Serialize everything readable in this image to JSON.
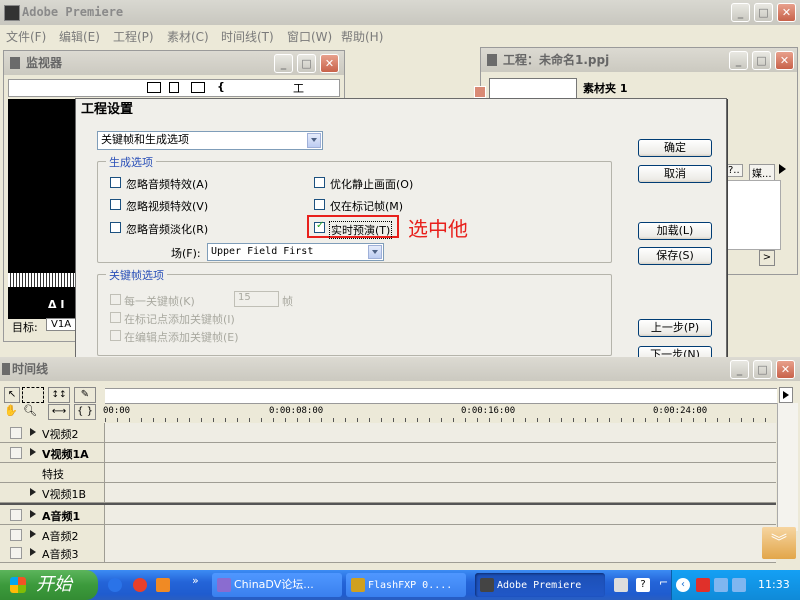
{
  "app": {
    "title": "Adobe Premiere",
    "menu": [
      "文件(F)",
      "编辑(E)",
      "工程(P)",
      "素材(C)",
      "时间线(T)",
      "窗口(W)",
      "帮助(H)"
    ]
  },
  "monitor": {
    "title": "监视器",
    "tool_label": "工",
    "target_label": "目标:",
    "target_value": "V1A",
    "marker_text": "Δ I"
  },
  "project": {
    "title": "工程：未命名1.ppj",
    "bin_label": "素材夹 1",
    "col_a": "?..",
    "col_b": "媒..."
  },
  "dialog": {
    "title": "工程设置",
    "category_select": "关键帧和生成选项",
    "render_group": {
      "label": "生成选项",
      "options": [
        {
          "label": "忽略音频特效(A)",
          "checked": false
        },
        {
          "label": "忽略视频特效(V)",
          "checked": false
        },
        {
          "label": "忽略音频淡化(R)",
          "checked": false
        },
        {
          "label": "优化静止画面(O)",
          "checked": false
        },
        {
          "label": "仅在标记帧(M)",
          "checked": false
        },
        {
          "label": "实时预演(T)",
          "checked": true
        }
      ],
      "field_label": "场(F):",
      "field_value": "Upper Field First"
    },
    "keyframe_group": {
      "label": "关键帧选项",
      "every_label": "每一关键帧(K)",
      "every_value": "15",
      "every_unit": "帧",
      "add_at_markers": "在标记点添加关键帧(I)",
      "add_at_edits": "在编辑点添加关键帧(E)"
    },
    "buttons": {
      "ok": "确定",
      "cancel": "取消",
      "load": "加载(L)",
      "save": "保存(S)",
      "prev": "上一步(P)",
      "next": "下一步(N)"
    }
  },
  "annotation": {
    "text": "选中他",
    "color": "#e8201c"
  },
  "timeline": {
    "title": "时间线",
    "timecodes": [
      "00:00",
      "0:00:08:00",
      "0:00:16:00",
      "0:00:24:00"
    ],
    "tracks": [
      {
        "name": "V视频2",
        "bold": false
      },
      {
        "name": "V视频1A",
        "bold": true
      },
      {
        "name": "特技",
        "bold": false
      },
      {
        "name": "V视频1B",
        "bold": false
      },
      {
        "name": "A音频1",
        "bold": true
      },
      {
        "name": "A音频2",
        "bold": false
      },
      {
        "name": "A音频3",
        "bold": false
      }
    ]
  },
  "taskbar": {
    "start_label": "开始",
    "tasks": [
      {
        "label": "ChinaDV论坛...",
        "active": false
      },
      {
        "label": "FlashFXP 0....",
        "active": false
      },
      {
        "label": "Adobe Premiere",
        "active": true
      }
    ],
    "clock": "11:33"
  }
}
